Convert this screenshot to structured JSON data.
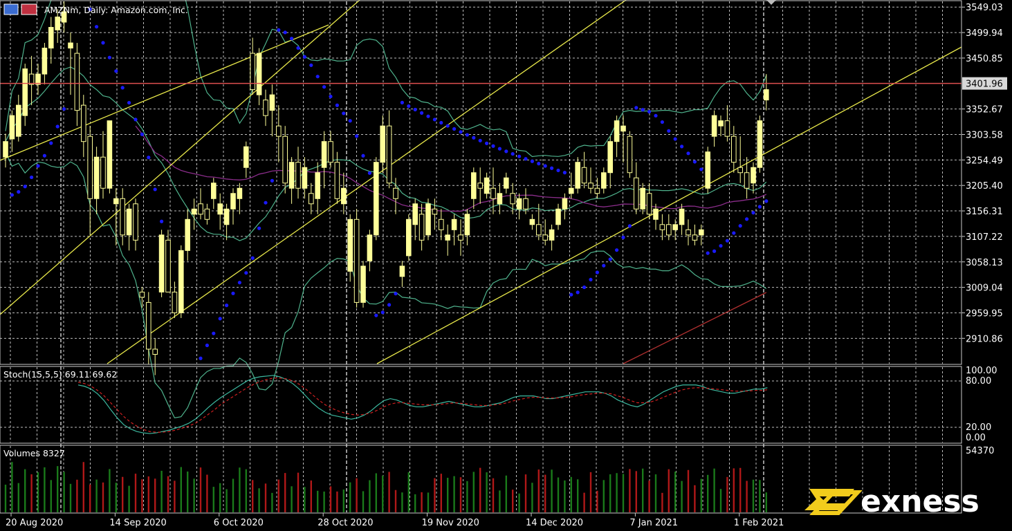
{
  "chart_data": {
    "type": "candlestick",
    "title": "AMZNm, Daily:  Amazon.com, Inc.",
    "symbol": "AMZNm",
    "timeframe": "Daily",
    "instrument": "Amazon.com, Inc.",
    "current_price": "3401.96",
    "ylim": [
      2862,
      3560
    ],
    "y_ticks": [
      "3549.03",
      "3499.94",
      "3450.85",
      "3401.96",
      "3352.67",
      "3303.58",
      "3254.49",
      "3205.40",
      "3156.31",
      "3107.22",
      "3058.13",
      "3009.04",
      "2959.95",
      "2910.86"
    ],
    "x_labels": [
      {
        "label": "20 Aug 2020",
        "index": 0
      },
      {
        "label": "14 Sep 2020",
        "index": 16
      },
      {
        "label": "6 Oct 2020",
        "index": 32
      },
      {
        "label": "28 Oct 2020",
        "index": 48
      },
      {
        "label": "19 Nov 2020",
        "index": 64
      },
      {
        "label": "14 Dec 2020",
        "index": 80
      },
      {
        "label": "7 Jan 2021",
        "index": 96
      },
      {
        "label": "1 Feb 2021",
        "index": 112
      }
    ],
    "candles": [
      [
        3260,
        3305,
        3240,
        3290
      ],
      [
        3295,
        3350,
        3270,
        3340
      ],
      [
        3300,
        3380,
        3290,
        3360
      ],
      [
        3340,
        3440,
        3320,
        3430
      ],
      [
        3420,
        3455,
        3360,
        3400
      ],
      [
        3400,
        3440,
        3380,
        3420
      ],
      [
        3420,
        3480,
        3400,
        3470
      ],
      [
        3470,
        3530,
        3440,
        3510
      ],
      [
        3505,
        3545,
        3480,
        3530
      ],
      [
        3520,
        3560,
        3500,
        3540
      ],
      [
        3470,
        3500,
        3380,
        3480
      ],
      [
        3460,
        3480,
        3320,
        3350
      ],
      [
        3360,
        3380,
        3260,
        3290
      ],
      [
        3300,
        3320,
        3110,
        3180
      ],
      [
        3180,
        3280,
        3150,
        3260
      ],
      [
        3260,
        3310,
        3180,
        3200
      ],
      [
        3200,
        3330,
        3190,
        3330
      ],
      [
        3170,
        3200,
        3090,
        3180
      ],
      [
        3180,
        3200,
        3090,
        3110
      ],
      [
        3110,
        3170,
        3080,
        3160
      ],
      [
        3170,
        3180,
        3080,
        3100
      ],
      [
        3000,
        3010,
        2970,
        2990
      ],
      [
        2980,
        3000,
        2860,
        2890
      ],
      [
        2890,
        2910,
        2840,
        2880
      ],
      [
        3000,
        3120,
        2990,
        3110
      ],
      [
        3100,
        3120,
        3000,
        3000
      ],
      [
        3000,
        3020,
        2950,
        2960
      ],
      [
        2960,
        3090,
        2950,
        3080
      ],
      [
        3080,
        3160,
        3060,
        3140
      ],
      [
        3150,
        3180,
        3120,
        3160
      ],
      [
        3170,
        3200,
        3140,
        3150
      ],
      [
        3160,
        3170,
        3130,
        3140
      ],
      [
        3180,
        3220,
        3160,
        3210
      ],
      [
        3150,
        3190,
        3120,
        3170
      ],
      [
        3130,
        3170,
        3100,
        3160
      ],
      [
        3160,
        3200,
        3130,
        3190
      ],
      [
        3180,
        3210,
        3150,
        3200
      ],
      [
        3240,
        3290,
        3220,
        3280
      ],
      [
        3460,
        3490,
        3380,
        3390
      ],
      [
        3380,
        3470,
        3360,
        3460
      ],
      [
        3370,
        3390,
        3320,
        3340
      ],
      [
        3350,
        3400,
        3300,
        3380
      ],
      [
        3320,
        3360,
        3250,
        3300
      ],
      [
        3300,
        3320,
        3190,
        3210
      ],
      [
        3200,
        3260,
        3170,
        3250
      ],
      [
        3250,
        3280,
        3180,
        3200
      ],
      [
        3200,
        3260,
        3180,
        3240
      ],
      [
        3190,
        3210,
        3150,
        3170
      ],
      [
        3180,
        3250,
        3150,
        3230
      ],
      [
        3240,
        3310,
        3200,
        3290
      ],
      [
        3290,
        3310,
        3240,
        3250
      ],
      [
        3250,
        3270,
        3170,
        3180
      ],
      [
        3170,
        3230,
        3150,
        3200
      ],
      [
        3040,
        3150,
        3020,
        3140
      ],
      [
        3140,
        3160,
        2970,
        2980
      ],
      [
        2980,
        3060,
        2970,
        3050
      ],
      [
        3060,
        3120,
        3040,
        3110
      ],
      [
        3110,
        3260,
        3100,
        3250
      ],
      [
        3250,
        3340,
        3230,
        3320
      ],
      [
        3320,
        3350,
        3200,
        3210
      ],
      [
        3200,
        3220,
        3150,
        3180
      ],
      [
        3030,
        3060,
        3010,
        3050
      ],
      [
        3070,
        3150,
        3060,
        3140
      ],
      [
        3130,
        3180,
        3100,
        3170
      ],
      [
        3150,
        3170,
        3080,
        3100
      ],
      [
        3110,
        3180,
        3100,
        3170
      ],
      [
        3160,
        3180,
        3120,
        3150
      ],
      [
        3140,
        3160,
        3100,
        3120
      ],
      [
        3100,
        3130,
        3070,
        3110
      ],
      [
        3120,
        3150,
        3090,
        3140
      ],
      [
        3110,
        3140,
        3070,
        3100
      ],
      [
        3110,
        3160,
        3090,
        3150
      ],
      [
        3180,
        3240,
        3160,
        3230
      ],
      [
        3210,
        3240,
        3170,
        3200
      ],
      [
        3190,
        3230,
        3180,
        3220
      ],
      [
        3200,
        3240,
        3150,
        3180
      ],
      [
        3170,
        3210,
        3150,
        3190
      ],
      [
        3200,
        3230,
        3190,
        3220
      ],
      [
        3190,
        3210,
        3150,
        3170
      ],
      [
        3160,
        3190,
        3140,
        3180
      ],
      [
        3180,
        3200,
        3150,
        3160
      ],
      [
        3130,
        3150,
        3120,
        3140
      ],
      [
        3130,
        3170,
        3100,
        3110
      ],
      [
        3110,
        3140,
        3090,
        3100
      ],
      [
        3100,
        3130,
        3080,
        3120
      ],
      [
        3130,
        3170,
        3120,
        3160
      ],
      [
        3160,
        3190,
        3140,
        3180
      ],
      [
        3190,
        3230,
        3180,
        3200
      ],
      [
        3200,
        3260,
        3190,
        3250
      ],
      [
        3240,
        3270,
        3200,
        3210
      ],
      [
        3210,
        3240,
        3190,
        3200
      ],
      [
        3200,
        3220,
        3180,
        3190
      ],
      [
        3200,
        3240,
        3190,
        3230
      ],
      [
        3230,
        3300,
        3200,
        3290
      ],
      [
        3290,
        3340,
        3260,
        3330
      ],
      [
        3310,
        3340,
        3250,
        3320
      ],
      [
        3300,
        3310,
        3220,
        3230
      ],
      [
        3220,
        3250,
        3150,
        3160
      ],
      [
        3160,
        3210,
        3150,
        3200
      ],
      [
        3190,
        3210,
        3140,
        3150
      ],
      [
        3140,
        3170,
        3120,
        3160
      ],
      [
        3130,
        3150,
        3100,
        3120
      ],
      [
        3130,
        3150,
        3100,
        3110
      ],
      [
        3120,
        3140,
        3100,
        3130
      ],
      [
        3130,
        3170,
        3110,
        3160
      ],
      [
        3120,
        3140,
        3090,
        3110
      ],
      [
        3110,
        3130,
        3090,
        3100
      ],
      [
        3110,
        3130,
        3090,
        3120
      ],
      [
        3200,
        3280,
        3190,
        3270
      ],
      [
        3300,
        3350,
        3280,
        3340
      ],
      [
        3320,
        3340,
        3300,
        3330
      ],
      [
        3330,
        3360,
        3290,
        3300
      ],
      [
        3300,
        3320,
        3230,
        3250
      ],
      [
        3240,
        3300,
        3210,
        3230
      ],
      [
        3230,
        3260,
        3180,
        3200
      ],
      [
        3210,
        3250,
        3190,
        3240
      ],
      [
        3240,
        3340,
        3230,
        3330
      ],
      [
        3370,
        3420,
        3350,
        3390
      ]
    ],
    "stoch": {
      "label": "Stoch(15,5,5) 69.11 69.62",
      "ylim": [
        0,
        100
      ],
      "y_ticks": [
        "100.00",
        "80.00",
        "20.00",
        "0.00"
      ],
      "main": [
        78,
        76,
        72,
        65,
        55,
        42,
        30,
        20,
        14,
        10,
        8,
        7,
        8,
        10,
        12,
        15,
        18,
        22,
        28,
        36,
        45,
        53,
        60,
        66,
        72,
        78,
        84,
        88,
        90,
        91,
        92,
        90,
        86,
        80,
        72,
        62,
        52,
        44,
        38,
        34,
        32,
        30,
        28,
        30,
        34,
        40,
        48,
        55,
        58,
        56,
        52,
        48,
        46,
        46,
        48,
        50,
        52,
        54,
        52,
        50,
        48,
        46,
        46,
        48,
        50,
        52,
        56,
        60,
        62,
        62,
        62,
        60,
        58,
        58,
        60,
        62,
        64,
        66,
        68,
        68,
        68,
        66,
        62,
        56,
        52,
        48,
        46,
        50,
        56,
        62,
        68,
        72,
        76,
        78,
        78,
        78,
        76,
        72,
        70,
        68,
        66,
        66,
        68,
        70,
        72,
        72,
        74,
        76,
        78,
        78,
        78,
        76,
        74,
        72,
        70,
        69
      ],
      "signal": [
        82,
        80,
        76,
        70,
        62,
        52,
        42,
        32,
        24,
        18,
        13,
        10,
        9,
        9,
        10,
        12,
        15,
        18,
        22,
        28,
        35,
        42,
        50,
        56,
        62,
        68,
        74,
        79,
        83,
        86,
        88,
        88,
        87,
        84,
        79,
        72,
        64,
        56,
        49,
        44,
        40,
        37,
        35,
        34,
        35,
        37,
        41,
        46,
        50,
        52,
        52,
        51,
        50,
        49,
        49,
        49,
        50,
        51,
        52,
        51,
        50,
        49,
        48,
        48,
        49,
        50,
        52,
        55,
        57,
        59,
        60,
        60,
        59,
        59,
        59,
        60,
        61,
        63,
        64,
        65,
        66,
        66,
        65,
        62,
        59,
        55,
        52,
        52,
        53,
        56,
        60,
        64,
        68,
        71,
        73,
        74,
        74,
        73,
        72,
        71,
        70,
        69,
        69,
        69,
        70,
        70,
        71,
        72,
        73,
        74,
        74,
        74,
        73,
        72,
        71,
        70
      ]
    },
    "volumes": {
      "label": "Volumes 8327",
      "y_ticks": [
        "54370"
      ],
      "max": 54370
    },
    "colors": {
      "candle": "#ffff99",
      "bollinger": "#4fb38d",
      "sar": "#1a1aff",
      "ma_slow": "#8b2d8b",
      "ma_red": "#b03030",
      "trendline": "#e8e84a",
      "price_line": "#e05050",
      "grid": "#ffffff",
      "stoch_main": "#3cb9a0",
      "stoch_signal": "#d02020",
      "vol_up": "#1a7a1a",
      "vol_down": "#b01818"
    }
  },
  "brand": {
    "name": "exness"
  }
}
